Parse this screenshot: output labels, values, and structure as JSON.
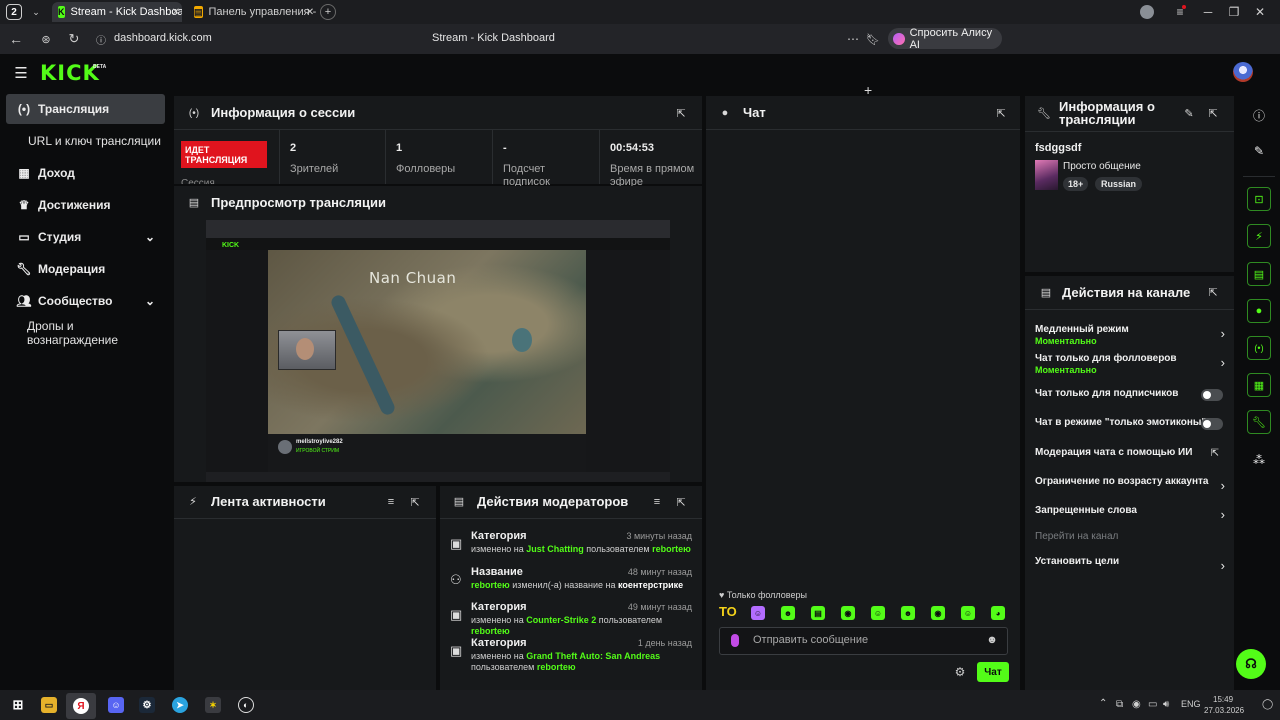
{
  "browser": {
    "tab_counter": "2",
    "tabs": [
      {
        "label": "Stream - Kick Dashboard",
        "active": true,
        "icon": "kick-icon"
      },
      {
        "label": "Панель управления - Do",
        "active": false,
        "icon": "document-icon"
      }
    ],
    "address": "dashboard.kick.com",
    "page_title": "Stream - Kick Dashboard",
    "alice_label": "Спросить Алису AI"
  },
  "kick": {
    "logo": "KICK",
    "logo_badge": "BETA",
    "sidebar": {
      "items": [
        {
          "label": "Трансляция",
          "icon": "broadcast-icon",
          "active": true
        },
        {
          "label": "URL и ключ трансляции",
          "icon": "",
          "active": false
        },
        {
          "label": "Доход",
          "icon": "revenue-icon",
          "active": false
        },
        {
          "label": "Достижения",
          "icon": "trophy-icon",
          "active": false
        },
        {
          "label": "Студия",
          "icon": "studio-icon",
          "active": false,
          "expandable": true
        },
        {
          "label": "Модерация",
          "icon": "wrench-icon",
          "active": false
        },
        {
          "label": "Сообщество",
          "icon": "community-icon",
          "active": false,
          "expandable": true
        },
        {
          "label": "Дропы и вознаграждение",
          "icon": "",
          "active": false
        }
      ]
    },
    "session": {
      "title": "Информация о сессии",
      "live_badge": "ИДЕТ ТРАНСЛЯЦИЯ",
      "live_sub": "Сессия",
      "stats": [
        {
          "value": "2",
          "label": "Зрителей"
        },
        {
          "value": "1",
          "label": "Фолловеры"
        },
        {
          "value": "-",
          "label": "Подсчет подписок"
        },
        {
          "value": "00:54:53",
          "label": "Время в прямом эфире"
        }
      ]
    },
    "preview": {
      "title": "Предпросмотр трансляции",
      "map_label": "Nan Chuan",
      "channel": "mellstroylive282",
      "category": "ИГРОВОЙ СТРИМ"
    },
    "activity": {
      "title": "Лента активности"
    },
    "mod_actions": {
      "title": "Действия модераторов",
      "rows": [
        {
          "title": "Категория",
          "time": "3 минуты назад",
          "prefix": "изменено на ",
          "target": "Just Chatting",
          "mid": " пользователем ",
          "user": "reborteю",
          "icon": "category-icon"
        },
        {
          "title": "Название",
          "time": "48 минут назад",
          "prefix": "",
          "target": "reborteю",
          "mid": " изменил(-а) название на ",
          "user": "коентерстрике",
          "icon": "title-icon"
        },
        {
          "title": "Категория",
          "time": "49 минут назад",
          "prefix": "изменено на ",
          "target": "Counter-Strike 2",
          "mid": " пользователем ",
          "user": "reborteю",
          "icon": "category-icon"
        },
        {
          "title": "Категория",
          "time": "1 день назад",
          "prefix": "изменено на ",
          "target": "Grand Theft Auto: San Andreas",
          "mid": " пользователем ",
          "user": "reborteю",
          "icon": "category-icon"
        }
      ]
    },
    "chat": {
      "title": "Чат",
      "followers_only": "Только фолловеры",
      "emote_first": "ТО",
      "placeholder": "Отправить сообщение",
      "send_label": "Чат"
    },
    "stream_info": {
      "title": "Информация о трансляции",
      "stream_title": "fsdggsdf",
      "category": "Просто общение",
      "tags": [
        "18+",
        "Russian"
      ]
    },
    "channel_actions": {
      "title": "Действия на канале",
      "items": [
        {
          "label": "Медленный режим",
          "sub": "Моментально",
          "control": "arrow"
        },
        {
          "label": "Чат только для фолловеров",
          "sub": "Моментально",
          "control": "arrow"
        },
        {
          "label": "Чат только для подписчиков",
          "sub": "",
          "control": "toggle"
        },
        {
          "label": "Чат в режиме \"только эмотиконы\"",
          "sub": "",
          "control": "toggle"
        },
        {
          "label": "Модерация чата с помощью ИИ",
          "sub": "",
          "control": "external"
        },
        {
          "label": "Ограничение по возрасту аккаунта",
          "sub": "",
          "control": "arrow"
        },
        {
          "label": "Запрещенные слова",
          "sub": "",
          "control": "arrow"
        },
        {
          "label": "Перейти на канал",
          "sub": "",
          "control": "none"
        },
        {
          "label": "Установить цели",
          "sub": "",
          "control": "arrow"
        }
      ]
    }
  },
  "taskbar": {
    "lang": "ENG",
    "time": "15:49",
    "date": "27.03.2026"
  },
  "colors": {
    "accent": "#53fc18",
    "live": "#e0141e",
    "panel": "#17191b",
    "background": "#0b0c0d"
  }
}
